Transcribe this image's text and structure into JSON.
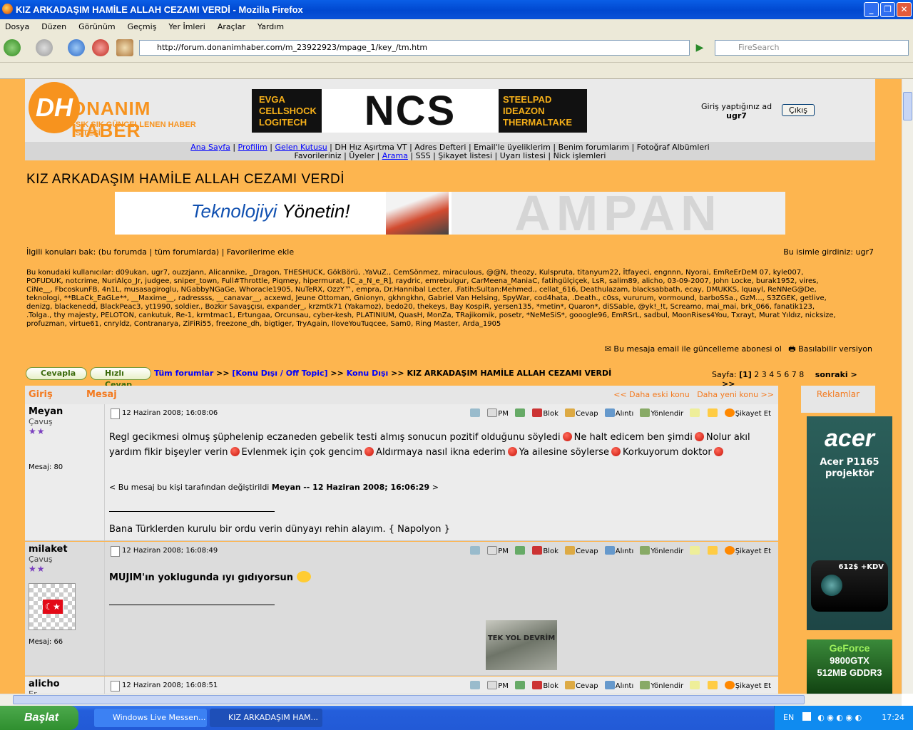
{
  "window": {
    "title": "KIZ ARKADAŞIM HAMİLE ALLAH CEZAMI VERDİ - Mozilla Firefox"
  },
  "menu": [
    "Dosya",
    "Düzen",
    "Görünüm",
    "Geçmiş",
    "Yer İmleri",
    "Araçlar",
    "Yardım"
  ],
  "address": {
    "url": "http://forum.donanimhaber.com/m_23922923/mpage_1/key_/tm.htm"
  },
  "search": {
    "placeholder": "FireSearch"
  },
  "site": {
    "logo_letters": "DH",
    "logo_name": "ONANIM HABER",
    "slogan": "SIK SIK GÜNCELLENEN HABER SİTESİ",
    "ad_left": [
      "EVGA",
      "CELLSHOCK",
      "LOGITECH"
    ],
    "ad_center": "NCS",
    "ad_right": [
      "STEELPAD",
      "IDEAZON",
      "THERMALTAKE"
    ],
    "login_label": "Giriş yaptığınız ad",
    "login_user": "ugr7",
    "logout": "Çıkış"
  },
  "nav": {
    "row1": [
      "Ana Sayfa",
      "Profilim",
      "Gelen Kutusu",
      "DH Hız Aşırtma VT",
      "Adres Defteri",
      "Email'le üyeliklerim",
      "Benim forumlarım",
      "Fotoğraf Albümleri"
    ],
    "row2": [
      "Favorileriniz",
      "Üyeler",
      "Arama",
      "SSS",
      "Şikayet listesi",
      "Uyarı listesi",
      "Nick işlemleri"
    ]
  },
  "topic": {
    "title": "KIZ ARKADAŞIM HAMİLE ALLAH CEZAMI VERDİ"
  },
  "banner": {
    "slogan_blue": "Teknolojiyi",
    "slogan_black": " Yönetin!",
    "brand": "AMPAN"
  },
  "related": {
    "left": "İlgili konuları bak: (bu forumda | tüm forumlarda) | Favorilerime ekle",
    "right": "Bu isimle girdiniz: ugr7"
  },
  "users_text": "Bu konudaki kullanıcılar: d09ukan, ugr7, ouzzjann, Alicannike, _Dragon, THESHUCK, GökBörü, .YaVuZ., CemSönmez, miraculous, @@N, theozy, Kulspruta, titanyum22, İtfayeci, engnnn, Nyorai, EmReErDeM 07, kyle007, POFUDUK, notcrime, NuriAlço_Jr, judgee, sniper_town, Full#Throttle, Piqmey, hipermurat, [C_a_N_e_R], raydric, emrebulgur, CarMeena_ManiaC, fatihgülçiçek, LsR, salim89, alicho, 03-09-2007, John Locke, burak1952, vires, CiNe__, FbcoskunFB, 4n1L, musasagiroglu, NGabbyNGaGe, Whoracle1905, NuTeRX, OzzY™, empra, Dr.Hannibal Lecter, .Fatih:Sultan:Mehmed., cellat_616, Deathulazam, blacksabbath, ecay, DMUKKS, lquayl, ReNNeG@De, teknologi, **BLaCk_EaGLe**, __Maxime__, radressss, __canavar__, acxewd, Jeune Ottoman, Gnionyn, gkhngkhn, Gabriel Van Helsing, SpyWar, cod4hata, .Death., c0ss, vururum, vormound, barboSSa., GzM..., S3ZGEK, getlive, denizg, blackenedd, BlackPeac3, yt1990, soldier., Bozkır Savaşçısı, expander_, krzmtk71 (Yakamoz), bedo20, thekeys, Bay KospiR, yersen135, *metin*, Quaron*, diSSable, @yk!_!t, Screamo, mai_mai, brk_066, fanatik123, .Tolga., thy majesty, PELOTON, cankutuk, Re-1, krmtmac1, Ertungaa, Orcunsau, cyber-kesh, PLATINIUM, QuasH, MonZa, TRajikomik, posetr, *NeMeSiS*, gooogle96, EmRSrL, sadbul, MoonRises4You, Txrayt, Murat Yıldız, nicksize, profuzman, virtue61, cnryldz, Contranarya, ZiFiRi55, freezone_dh, bigtiger, TryAgain, IloveYouTuqcee, Sam0, Ring Master, Arda_1905",
  "subscribe": {
    "email": "Bu mesaja email ile güncelleme abonesi ol",
    "print": "Basılabilir versiyon"
  },
  "actions": {
    "reply": "Cevapla",
    "quick_reply": "Hızlı Cevap"
  },
  "breadcrumb": {
    "all": "Tüm forumlar",
    "sep": ">>",
    "cat": "[Konu Dışı / Off Topic]",
    "sub": "Konu Dışı",
    "topic": "KIZ ARKADAŞIM HAMİLE ALLAH CEZAMI VERDİ"
  },
  "pager": {
    "label": "Sayfa:",
    "current": "[1]",
    "pages": [
      "2",
      "3",
      "4",
      "5",
      "6",
      "7",
      "8"
    ],
    "next": "sonraki >",
    "last": ">>"
  },
  "forum_head": {
    "login": "Giriş",
    "message": "Mesaj",
    "older": "<< Daha eski konu",
    "newer": "Daha yeni konu >>"
  },
  "ads": {
    "head": "Reklamlar",
    "acer_brand": "acer",
    "acer_model": "Acer P1165 projektör",
    "acer_spec": "612$ +KDV",
    "gf_1": "GeForce",
    "gf_2": "9800GTX",
    "gf_3": "512MB GDDR3"
  },
  "tools": {
    "pm": "PM",
    "block": "Blok",
    "reply": "Cevap",
    "quote": "Alıntı",
    "forward": "Yönlendir",
    "report": "Şikayet Et"
  },
  "posts": [
    {
      "user": "Meyan",
      "rank": "Çavuş",
      "stars": "★★",
      "count": "Mesaj: 80",
      "date": "12 Haziran 2008; 16:08:06",
      "parts": [
        "Regl gecikmesi olmuş şüphelenip eczaneden gebelik testi almış sonucun pozitif olduğunu söyledi",
        "Ne halt edicem ben şimdi",
        "Nolur akıl yardım fikir bişeyler verin",
        "Evlenmek için çok gencim",
        "Aldırmaya nasıl ikna ederim",
        "Ya ailesine söylerse",
        "Korkuyorum doktor"
      ],
      "edit_prefix": "< Bu mesaj bu kişi tarafından değiştirildi",
      "edit_user": "Meyan",
      "edit_date": "-- 12 Haziran 2008; 16:06:29",
      "edit_suffix": ">",
      "signature": "Bana Türklerden kurulu bir ordu verin dünyayı rehin alayım. { Napolyon }"
    },
    {
      "user": "milaket",
      "rank": "Çavuş",
      "stars": "★★",
      "count": "Mesaj: 66",
      "date": "12 Haziran 2008; 16:08:49",
      "text": "MUJIM'ın yoklugunda ıyı gıdıyorsun",
      "avatar_flag": "☾★",
      "sig_image_text": "TEK YOL DEVRİM"
    },
    {
      "user": "alicho",
      "rank": "Er",
      "date": "12 Haziran 2008; 16:08:51"
    }
  ],
  "taskbar": {
    "start": "Başlat",
    "task1": "Windows Live Messen...",
    "task2": "KIZ ARKADAŞIM HAM...",
    "lang": "EN",
    "clock": "17:24"
  }
}
